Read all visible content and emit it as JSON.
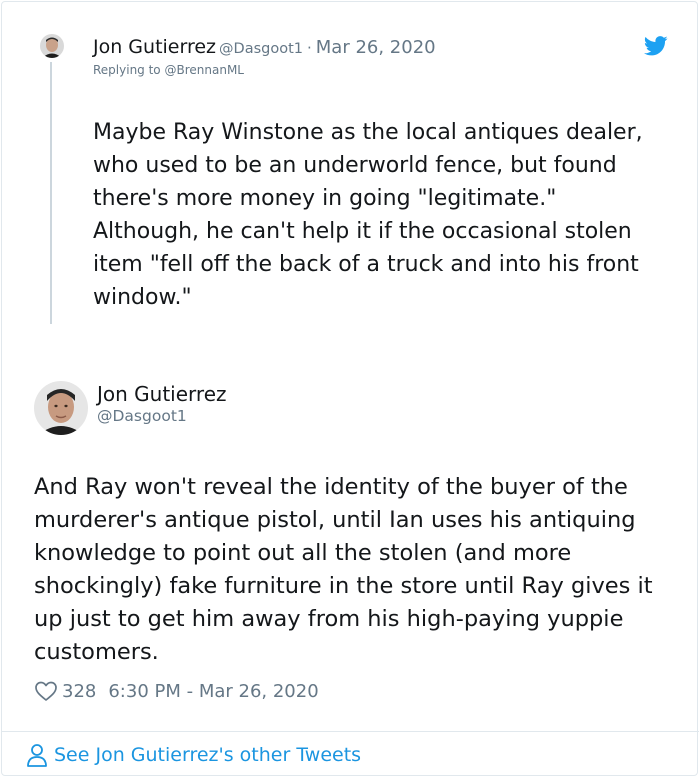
{
  "parent_tweet": {
    "name": "Jon Gutierrez",
    "handle": "@Dasgoot1",
    "separator": "·",
    "date": "Mar 26, 2020",
    "replying_prefix": "Replying to",
    "replying_mention": "@BrennanML",
    "text": "Maybe Ray Winstone as the local antiques dealer, who used to be an underworld fence, but found there's more money in going \"legitimate.\" Although, he can't help it if the occasional stolen item \"fell off the back of a truck and into his front window.\""
  },
  "main_tweet": {
    "name": "Jon Gutierrez",
    "handle": "@Dasgoot1",
    "text": "And Ray won't reveal the identity of the buyer of the murderer's antique pistol, until Ian uses his antiquing knowledge to point out all the stolen (and more shockingly) fake furniture in the store until Ray gives it up just to get him away from his high-paying yuppie customers.",
    "likes": "328",
    "timestamp": "6:30 PM - Mar 26, 2020"
  },
  "footer": {
    "link_text": "See Jon Gutierrez's other Tweets"
  },
  "icons": {
    "brand": "twitter-bird-icon",
    "like": "heart-icon",
    "profile": "person-icon"
  },
  "colors": {
    "brand_blue": "#1da1f2",
    "link_blue": "#1b95e0",
    "secondary_text": "#657786",
    "primary_text": "#14171a",
    "thread_line": "#ccd6dd",
    "border": "#e1e8ed"
  }
}
